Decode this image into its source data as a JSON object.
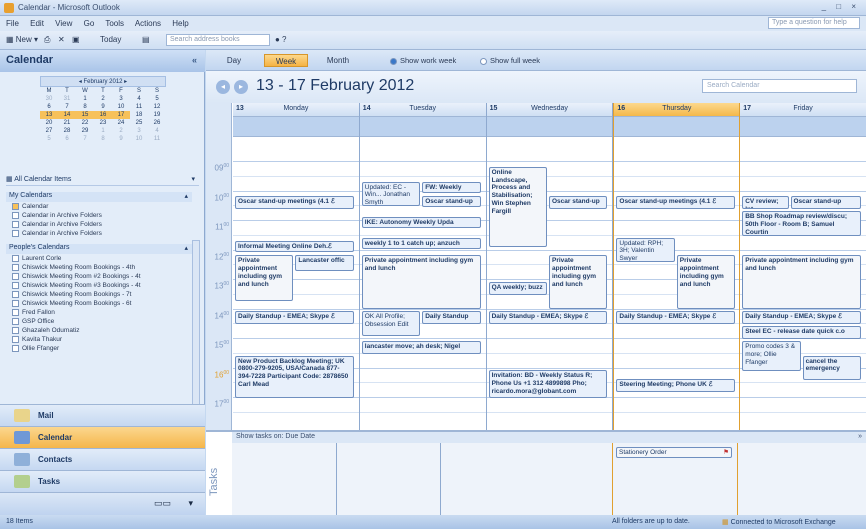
{
  "window": {
    "title": "Calendar - Microsoft Outlook",
    "controls": "_ □ ×"
  },
  "menu": [
    "File",
    "Edit",
    "View",
    "Go",
    "Tools",
    "Actions",
    "Help"
  ],
  "ask_placeholder": "Type a question for help",
  "toolbar": {
    "new": "New",
    "today": "Today",
    "search_placeholder": "Search address books"
  },
  "nav": {
    "title": "Calendar",
    "minical": {
      "month": "February 2012",
      "weekdays": [
        "M",
        "T",
        "W",
        "T",
        "F",
        "S",
        "S"
      ],
      "weeks": [
        [
          "30",
          "31",
          "1",
          "2",
          "3",
          "4",
          "5"
        ],
        [
          "6",
          "7",
          "8",
          "9",
          "10",
          "11",
          "12"
        ],
        [
          "13",
          "14",
          "15",
          "16",
          "17",
          "18",
          "19"
        ],
        [
          "20",
          "21",
          "22",
          "23",
          "24",
          "25",
          "26"
        ],
        [
          "27",
          "28",
          "29",
          "1",
          "2",
          "3",
          "4"
        ],
        [
          "5",
          "6",
          "7",
          "8",
          "9",
          "10",
          "11"
        ]
      ]
    },
    "all_calendar_items": "All Calendar Items",
    "my_calendars_header": "My Calendars",
    "my_calendars": [
      "Calendar",
      "Calendar in Archive Folders",
      "Calendar in Archive Folders",
      "Calendar in Archive Folders"
    ],
    "peoples_header": "People's Calendars",
    "peoples_calendars": [
      "Laurent Corle",
      "Chiswick Meeting Room Bookings - 4th",
      "Chiswick Meeting Room #2 Bookings - 4t",
      "Chiswick Meeting Room #3 Bookings - 4t",
      "Chiswick Meeting Room Bookings - 7t",
      "Chiswick Meeting Room Bookings - 6t",
      "Fred Fallon",
      "GSP Office",
      "Ghazaleh Odumatiz",
      "Kavita Thakur",
      "Ollie Ffanger"
    ],
    "buttons": [
      "Mail",
      "Calendar",
      "Contacts",
      "Tasks"
    ]
  },
  "views": {
    "day": "Day",
    "week": "Week",
    "month": "Month",
    "show_work_week": "Show work week",
    "show_full_week": "Show full week"
  },
  "range": "13 - 17 February 2012",
  "search_calendar_placeholder": "Search Calendar",
  "days": [
    {
      "num": "13",
      "name": "Monday"
    },
    {
      "num": "14",
      "name": "Tuesday"
    },
    {
      "num": "15",
      "name": "Wednesday"
    },
    {
      "num": "16",
      "name": "Thursday"
    },
    {
      "num": "17",
      "name": "Friday"
    }
  ],
  "hours": [
    "09",
    "10",
    "11",
    "12",
    "13",
    "14",
    "15",
    "16",
    "17"
  ],
  "hour_suffix": "00",
  "events": {
    "mon": [
      "Oscar stand-up meetings (4.1 ℰ",
      "Informal Meeting Online Deh.ℰ",
      "Private appointment including gym and lunch",
      "Lancaster offic",
      "Daily Standup - EMEA; Skype ℰ",
      "New Product Backlog Meeting; UK 0800-279-9205, USA/Canada 877-394-7228 Participant Code: 2878650 Carl Mead"
    ],
    "tue": [
      "Updated: EC - Win... Jonathan Smyth",
      "FW: Weekly",
      "Oscar stand-up",
      "IKE: Autonomy Weekly Upda",
      "weekly 1 to 1 catch up; anzuch",
      "Private appointment including gym and lunch",
      "OK All Profile; Obsession Edit",
      "Daily Standup",
      "lancaster move; ah desk; Nigel"
    ],
    "wed": [
      "Online Landscape, Process and Stabilisation; Win Stephen Fargill",
      "Oscar stand-up",
      "Private appointment including gym and lunch",
      "QA weekly; buzz",
      "Daily Standup - EMEA; Skype ℰ",
      "Invitation: BD - Weekly Status R; Phone Us +1 312 4899898 Pho; ricardo.mora@globant.com"
    ],
    "thu": [
      "Oscar stand-up meetings (4.1 ℰ",
      "Updated: RPH; 3H; Valentin Swyer",
      "Private appointment including gym and lunch",
      "Daily Standup - EMEA; Skype ℰ",
      "Steering Meeting; Phone UK ℰ"
    ],
    "fri": [
      "CV review; Int",
      "Oscar stand-up",
      "BB Shop Roadmap review/discu; 50th Floor - Room B; Samuel Courtin",
      "Private appointment including gym and lunch",
      "Daily Standup - EMEA; Skype ℰ",
      "Steel EC - release date quick c.o",
      "Promo codes 3 & more; Ollie Ffanger",
      "cancel the emergency"
    ]
  },
  "tasks": {
    "label": "Tasks",
    "show_by": "Show tasks on: Due Date",
    "items": [
      "Stationery Order"
    ]
  },
  "status": {
    "items": "18 Items",
    "folders": "All folders are up to date.",
    "connected": "Connected to Microsoft Exchange"
  }
}
